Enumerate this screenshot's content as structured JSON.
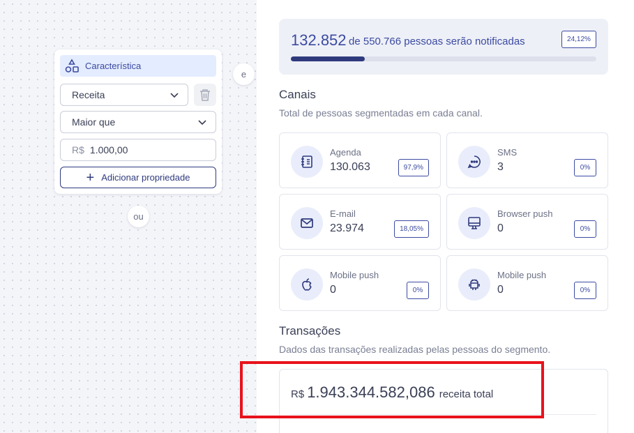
{
  "canvas": {
    "condition": {
      "header_label": "Característica",
      "field_value": "Receita",
      "operator_value": "Maior que",
      "currency_symbol": "R$",
      "amount_value": "1.000,00",
      "add_property_label": "Adicionar propriedade"
    },
    "and_connector": "e",
    "or_connector": "ou"
  },
  "panel": {
    "reach": {
      "count": "132.852",
      "text": "de 550.766 pessoas serão notificadas",
      "percent_label": "24,12%",
      "progress_fraction": 0.2412
    },
    "channels_title": "Canais",
    "channels_subtitle": "Total de pessoas segmentadas em cada canal.",
    "channels": [
      {
        "label": "Agenda",
        "value": "130.063",
        "percent": "97,9%",
        "icon": "notebook-icon"
      },
      {
        "label": "SMS",
        "value": "3",
        "percent": "0%",
        "icon": "chat-bubble-icon"
      },
      {
        "label": "E-mail",
        "value": "23.974",
        "percent": "18,05%",
        "icon": "envelope-icon"
      },
      {
        "label": "Browser push",
        "value": "0",
        "percent": "0%",
        "icon": "monitor-icon"
      },
      {
        "label": "Mobile push",
        "value": "0",
        "percent": "0%",
        "icon": "apple-icon"
      },
      {
        "label": "Mobile push",
        "value": "0",
        "percent": "0%",
        "icon": "android-icon"
      }
    ],
    "transactions_title": "Transações",
    "transactions_subtitle": "Dados das transações realizadas pelas pessoas do segmento.",
    "revenue": {
      "currency": "R$",
      "amount": "1.943.344.582,086",
      "label": "receita total"
    }
  },
  "colors": {
    "accent": "#3b4aa1",
    "accent_dark": "#2f3a7d",
    "highlight": "#e8121b"
  }
}
